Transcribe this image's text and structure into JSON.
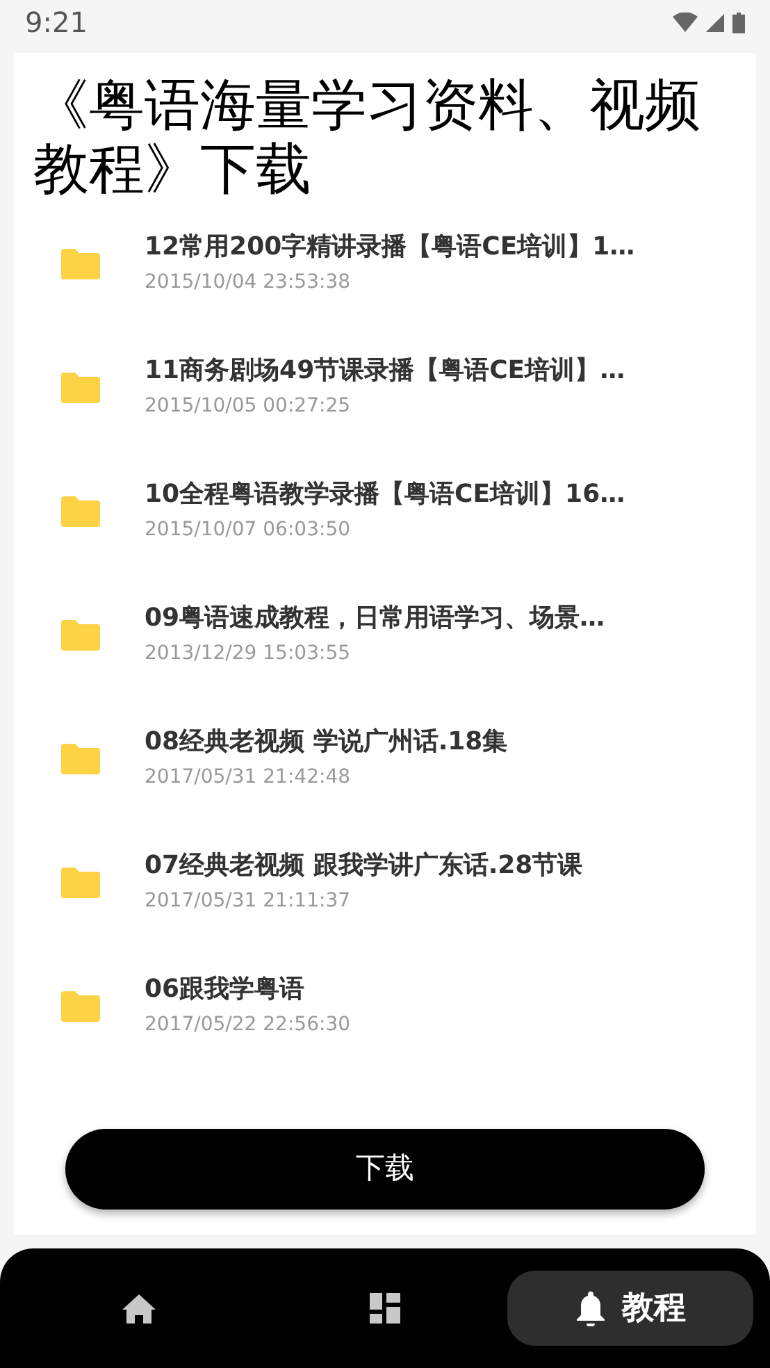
{
  "status_bar": {
    "time": "9:21"
  },
  "title": "《粤语海量学习资料、视频教程》下载",
  "files": [
    {
      "name": "12常用200字精讲录播【粤语CE培训】1…",
      "date": "2015/10/04 23:53:38"
    },
    {
      "name": "11商务剧场49节课录播【粤语CE培训】…",
      "date": "2015/10/05 00:27:25"
    },
    {
      "name": "10全程粤语教学录播【粤语CE培训】16…",
      "date": "2015/10/07 06:03:50"
    },
    {
      "name": "09粤语速成教程，日常用语学习、场景…",
      "date": "2013/12/29 15:03:55"
    },
    {
      "name": "08经典老视频 学说广州话.18集",
      "date": "2017/05/31 21:42:48"
    },
    {
      "name": "07经典老视频 跟我学讲广东话.28节课",
      "date": "2017/05/31 21:11:37"
    },
    {
      "name": "06跟我学粤语",
      "date": "2017/05/22 22:56:30"
    }
  ],
  "download_button": "下载",
  "nav": [
    {
      "selected": false
    },
    {
      "selected": false
    },
    {
      "label": "教程",
      "selected": true
    }
  ]
}
